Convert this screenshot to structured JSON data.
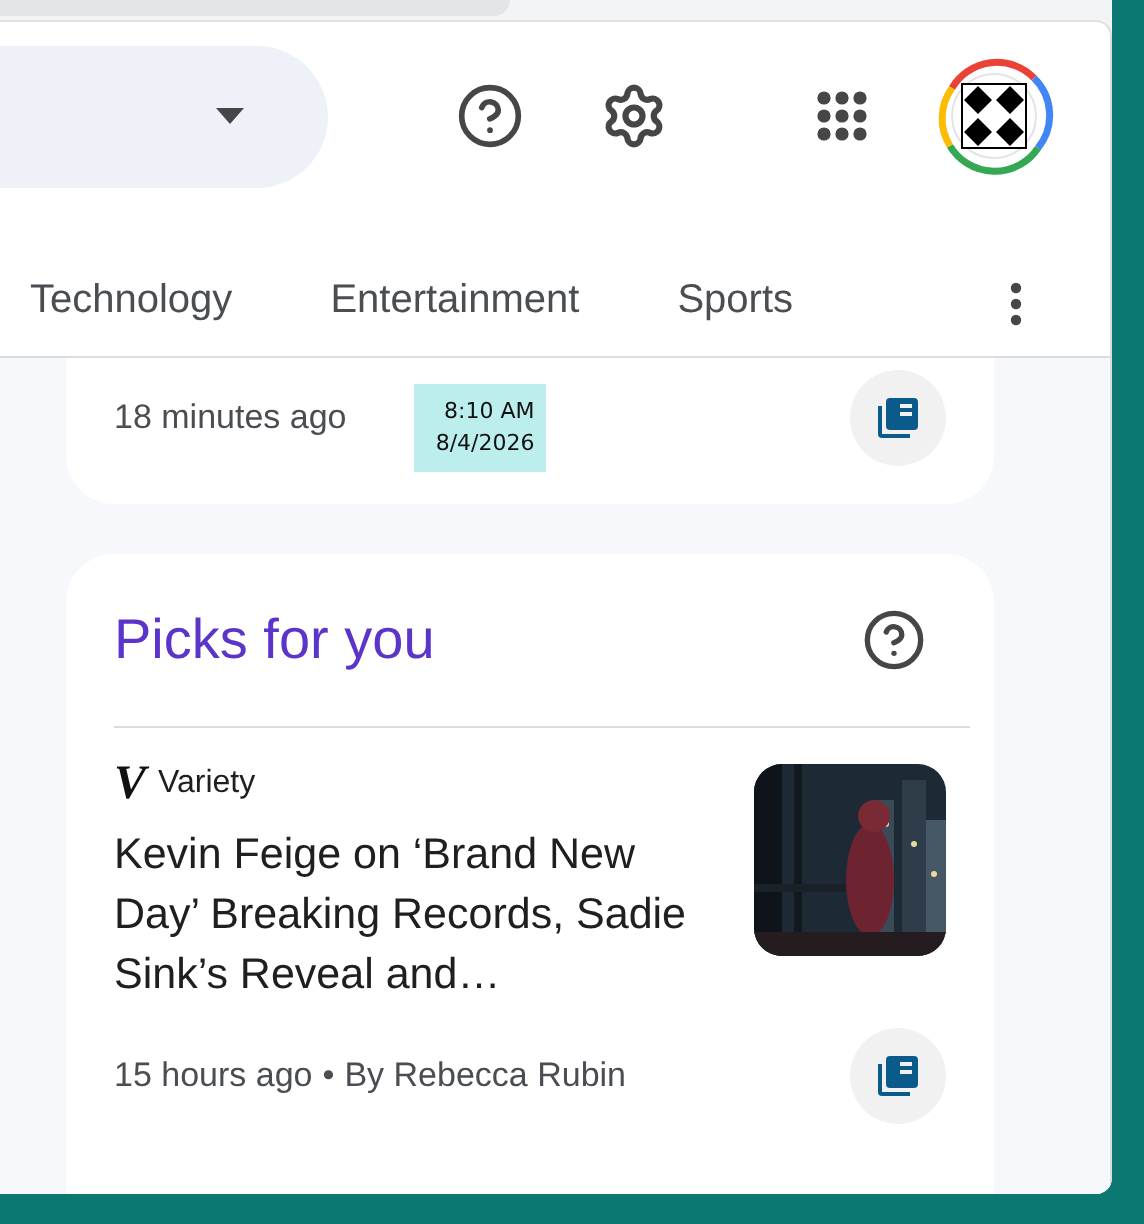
{
  "tabs": [
    {
      "label": "Technology",
      "selected": false
    },
    {
      "label": "Entertainment",
      "selected": false
    },
    {
      "label": "Sports",
      "selected": false
    }
  ],
  "top_story": {
    "time": "18 minutes ago",
    "timestamp": {
      "time": "8:10 AM",
      "date": "8/4/2026"
    }
  },
  "picks": {
    "title": "Picks for you",
    "article": {
      "logo": "V",
      "source": "Variety",
      "headline": "Kevin Feige on ‘Brand New Day’ Breaking Records, Sadie Sink’s Reveal and…",
      "time": "15 hours ago",
      "separator": "•",
      "byline": "By Rebecca Rubin"
    }
  }
}
